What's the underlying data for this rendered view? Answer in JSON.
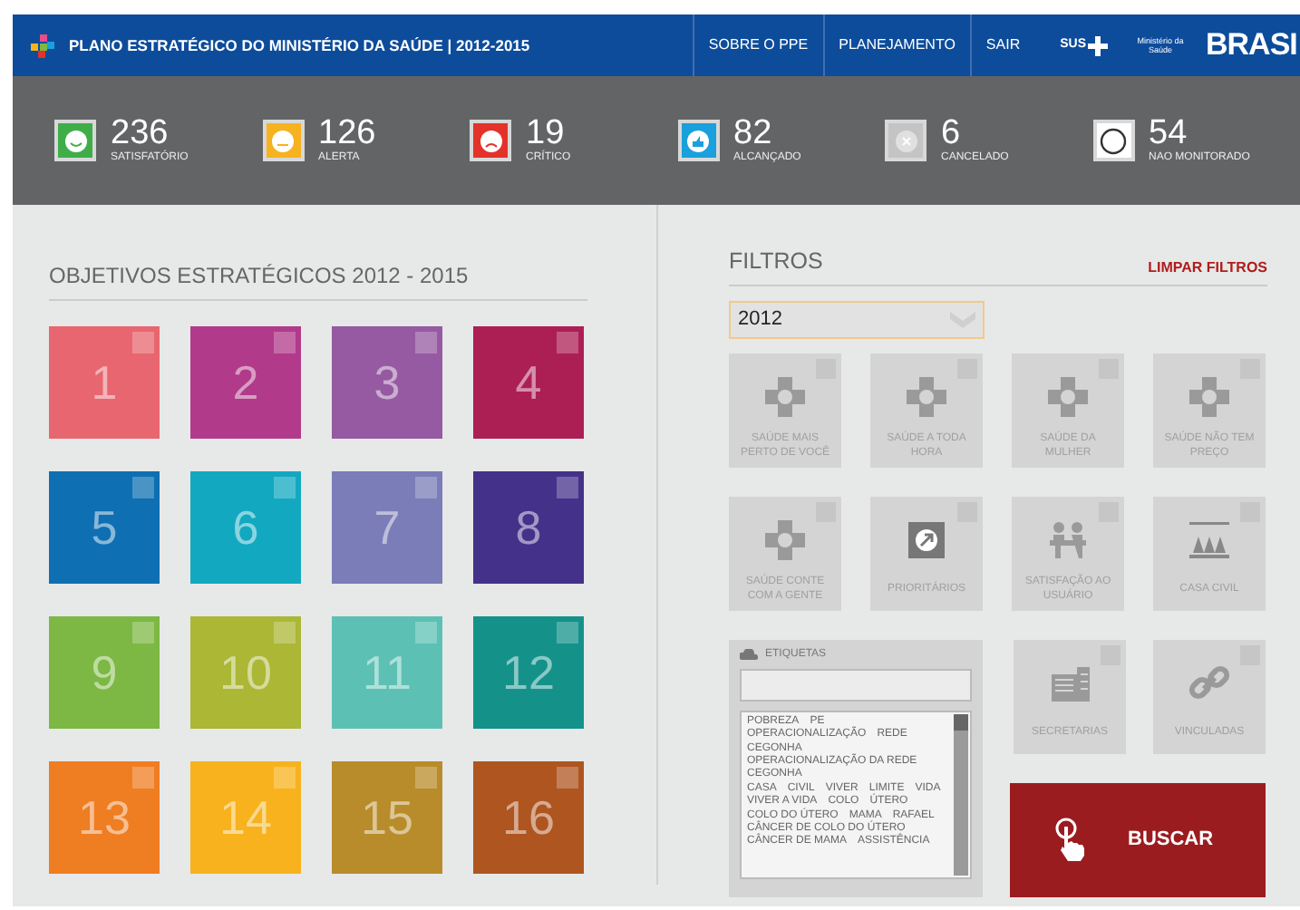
{
  "header": {
    "title": "PLANO ESTRATÉGICO DO MINISTÉRIO DA SAÚDE | 2012-2015",
    "nav": [
      "SOBRE O PPE",
      "PLANEJAMENTO",
      "SAIR"
    ],
    "sus": "SUS",
    "ministry": "Ministério da Saúde",
    "brand": "BRASI"
  },
  "stats": [
    {
      "value": "236",
      "label": "SATISFATÓRIO",
      "kind": "satisfied",
      "color": "#3fae49"
    },
    {
      "value": "126",
      "label": "ALERTA",
      "kind": "alert",
      "color": "#f6b21f"
    },
    {
      "value": "19",
      "label": "CRÍTICO",
      "kind": "critical",
      "color": "#e2322a"
    },
    {
      "value": "82",
      "label": "ALCANÇADO",
      "kind": "achieved",
      "color": "#1aa0dc"
    },
    {
      "value": "6",
      "label": "CANCELADO",
      "kind": "cancelled",
      "color": "#c4c4c4"
    },
    {
      "value": "54",
      "label": "NAO MONITORADO",
      "kind": "unmonitored",
      "color": "#ffffff"
    }
  ],
  "objectives": {
    "title": "OBJETIVOS ESTRATÉGICOS 2012 - 2015",
    "tiles": [
      {
        "number": "1",
        "color": "#e8666f",
        "checked": false
      },
      {
        "number": "2",
        "color": "#b13a8a",
        "checked": false
      },
      {
        "number": "3",
        "color": "#955aa1",
        "checked": false
      },
      {
        "number": "4",
        "color": "#ac1f55",
        "checked": false
      },
      {
        "number": "5",
        "color": "#0e6fb2",
        "checked": false
      },
      {
        "number": "6",
        "color": "#12a9c0",
        "checked": false
      },
      {
        "number": "7",
        "color": "#7a7db7",
        "checked": false
      },
      {
        "number": "8",
        "color": "#44318a",
        "checked": false
      },
      {
        "number": "9",
        "color": "#7cb843",
        "checked": false
      },
      {
        "number": "10",
        "color": "#abb735",
        "checked": false
      },
      {
        "number": "11",
        "color": "#5cc1b4",
        "checked": false
      },
      {
        "number": "12",
        "color": "#14928a",
        "checked": false
      },
      {
        "number": "13",
        "color": "#ef7d22",
        "checked": false
      },
      {
        "number": "14",
        "color": "#f7b21d",
        "checked": false
      },
      {
        "number": "15",
        "color": "#b88c2a",
        "checked": false
      },
      {
        "number": "16",
        "color": "#ae5520",
        "checked": false
      }
    ]
  },
  "filters": {
    "title": "FILTROS",
    "clear": "LIMPAR FILTROS",
    "year": "2012",
    "items": [
      {
        "label": "SAÚDE MAIS PERTO DE VOCÊ",
        "kind": "cross",
        "checked": false
      },
      {
        "label": "SAÚDE A TODA HORA",
        "kind": "cross",
        "checked": false
      },
      {
        "label": "SAÚDE DA MULHER",
        "kind": "cross",
        "checked": false
      },
      {
        "label": "SAÚDE NÃO TEM PREÇO",
        "kind": "cross",
        "checked": false
      },
      {
        "label": "SAÚDE CONTE COM A GENTE",
        "kind": "cross",
        "checked": false
      },
      {
        "label": "PRIORITÁRIOS",
        "kind": "arrow",
        "checked": false
      },
      {
        "label": "SATISFAÇÃO AO USUÁRIO",
        "kind": "people",
        "checked": false
      },
      {
        "label": "CASA CIVIL",
        "kind": "columns",
        "checked": false
      }
    ],
    "tags": {
      "title": "ETIQUETAS",
      "lines": [
        [
          "POBREZA",
          "PE"
        ],
        [
          "OPERACIONALIZAÇÃO",
          "REDE"
        ],
        [
          "CEGONHA"
        ],
        [
          "OPERACIONALIZAÇÃO DA REDE CEGONHA"
        ],
        [
          "CASA",
          "CIVIL",
          "VIVER",
          "LIMITE",
          "VIDA"
        ],
        [
          "VIVER A VIDA",
          "COLO",
          "ÚTERO"
        ],
        [
          "COLO DO ÚTERO",
          "MAMA",
          "RAFAEL"
        ],
        [
          "CÂNCER DE COLO DO ÚTERO"
        ],
        [
          "CÂNCER DE MAMA",
          "ASSISTÊNCIA"
        ]
      ]
    },
    "extra": [
      {
        "label": "SECRETARIAS",
        "kind": "building",
        "checked": false
      },
      {
        "label": "VINCULADAS",
        "kind": "link",
        "checked": false
      }
    ],
    "search": "BUSCAR"
  }
}
